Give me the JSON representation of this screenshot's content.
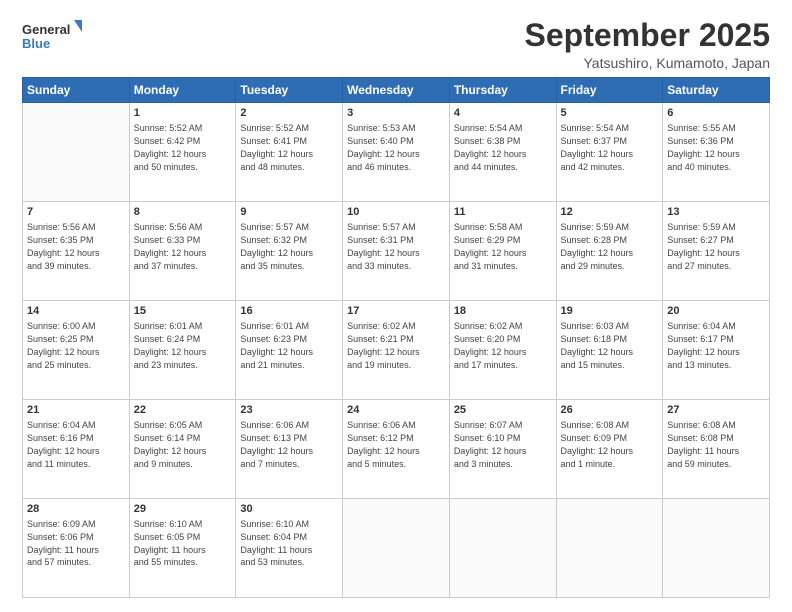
{
  "logo": {
    "line1": "General",
    "line2": "Blue"
  },
  "title": "September 2025",
  "subtitle": "Yatsushiro, Kumamoto, Japan",
  "days_header": [
    "Sunday",
    "Monday",
    "Tuesday",
    "Wednesday",
    "Thursday",
    "Friday",
    "Saturday"
  ],
  "weeks": [
    [
      {
        "day": "",
        "text": ""
      },
      {
        "day": "1",
        "text": "Sunrise: 5:52 AM\nSunset: 6:42 PM\nDaylight: 12 hours\nand 50 minutes."
      },
      {
        "day": "2",
        "text": "Sunrise: 5:52 AM\nSunset: 6:41 PM\nDaylight: 12 hours\nand 48 minutes."
      },
      {
        "day": "3",
        "text": "Sunrise: 5:53 AM\nSunset: 6:40 PM\nDaylight: 12 hours\nand 46 minutes."
      },
      {
        "day": "4",
        "text": "Sunrise: 5:54 AM\nSunset: 6:38 PM\nDaylight: 12 hours\nand 44 minutes."
      },
      {
        "day": "5",
        "text": "Sunrise: 5:54 AM\nSunset: 6:37 PM\nDaylight: 12 hours\nand 42 minutes."
      },
      {
        "day": "6",
        "text": "Sunrise: 5:55 AM\nSunset: 6:36 PM\nDaylight: 12 hours\nand 40 minutes."
      }
    ],
    [
      {
        "day": "7",
        "text": "Sunrise: 5:56 AM\nSunset: 6:35 PM\nDaylight: 12 hours\nand 39 minutes."
      },
      {
        "day": "8",
        "text": "Sunrise: 5:56 AM\nSunset: 6:33 PM\nDaylight: 12 hours\nand 37 minutes."
      },
      {
        "day": "9",
        "text": "Sunrise: 5:57 AM\nSunset: 6:32 PM\nDaylight: 12 hours\nand 35 minutes."
      },
      {
        "day": "10",
        "text": "Sunrise: 5:57 AM\nSunset: 6:31 PM\nDaylight: 12 hours\nand 33 minutes."
      },
      {
        "day": "11",
        "text": "Sunrise: 5:58 AM\nSunset: 6:29 PM\nDaylight: 12 hours\nand 31 minutes."
      },
      {
        "day": "12",
        "text": "Sunrise: 5:59 AM\nSunset: 6:28 PM\nDaylight: 12 hours\nand 29 minutes."
      },
      {
        "day": "13",
        "text": "Sunrise: 5:59 AM\nSunset: 6:27 PM\nDaylight: 12 hours\nand 27 minutes."
      }
    ],
    [
      {
        "day": "14",
        "text": "Sunrise: 6:00 AM\nSunset: 6:25 PM\nDaylight: 12 hours\nand 25 minutes."
      },
      {
        "day": "15",
        "text": "Sunrise: 6:01 AM\nSunset: 6:24 PM\nDaylight: 12 hours\nand 23 minutes."
      },
      {
        "day": "16",
        "text": "Sunrise: 6:01 AM\nSunset: 6:23 PM\nDaylight: 12 hours\nand 21 minutes."
      },
      {
        "day": "17",
        "text": "Sunrise: 6:02 AM\nSunset: 6:21 PM\nDaylight: 12 hours\nand 19 minutes."
      },
      {
        "day": "18",
        "text": "Sunrise: 6:02 AM\nSunset: 6:20 PM\nDaylight: 12 hours\nand 17 minutes."
      },
      {
        "day": "19",
        "text": "Sunrise: 6:03 AM\nSunset: 6:18 PM\nDaylight: 12 hours\nand 15 minutes."
      },
      {
        "day": "20",
        "text": "Sunrise: 6:04 AM\nSunset: 6:17 PM\nDaylight: 12 hours\nand 13 minutes."
      }
    ],
    [
      {
        "day": "21",
        "text": "Sunrise: 6:04 AM\nSunset: 6:16 PM\nDaylight: 12 hours\nand 11 minutes."
      },
      {
        "day": "22",
        "text": "Sunrise: 6:05 AM\nSunset: 6:14 PM\nDaylight: 12 hours\nand 9 minutes."
      },
      {
        "day": "23",
        "text": "Sunrise: 6:06 AM\nSunset: 6:13 PM\nDaylight: 12 hours\nand 7 minutes."
      },
      {
        "day": "24",
        "text": "Sunrise: 6:06 AM\nSunset: 6:12 PM\nDaylight: 12 hours\nand 5 minutes."
      },
      {
        "day": "25",
        "text": "Sunrise: 6:07 AM\nSunset: 6:10 PM\nDaylight: 12 hours\nand 3 minutes."
      },
      {
        "day": "26",
        "text": "Sunrise: 6:08 AM\nSunset: 6:09 PM\nDaylight: 12 hours\nand 1 minute."
      },
      {
        "day": "27",
        "text": "Sunrise: 6:08 AM\nSunset: 6:08 PM\nDaylight: 11 hours\nand 59 minutes."
      }
    ],
    [
      {
        "day": "28",
        "text": "Sunrise: 6:09 AM\nSunset: 6:06 PM\nDaylight: 11 hours\nand 57 minutes."
      },
      {
        "day": "29",
        "text": "Sunrise: 6:10 AM\nSunset: 6:05 PM\nDaylight: 11 hours\nand 55 minutes."
      },
      {
        "day": "30",
        "text": "Sunrise: 6:10 AM\nSunset: 6:04 PM\nDaylight: 11 hours\nand 53 minutes."
      },
      {
        "day": "",
        "text": ""
      },
      {
        "day": "",
        "text": ""
      },
      {
        "day": "",
        "text": ""
      },
      {
        "day": "",
        "text": ""
      }
    ]
  ]
}
